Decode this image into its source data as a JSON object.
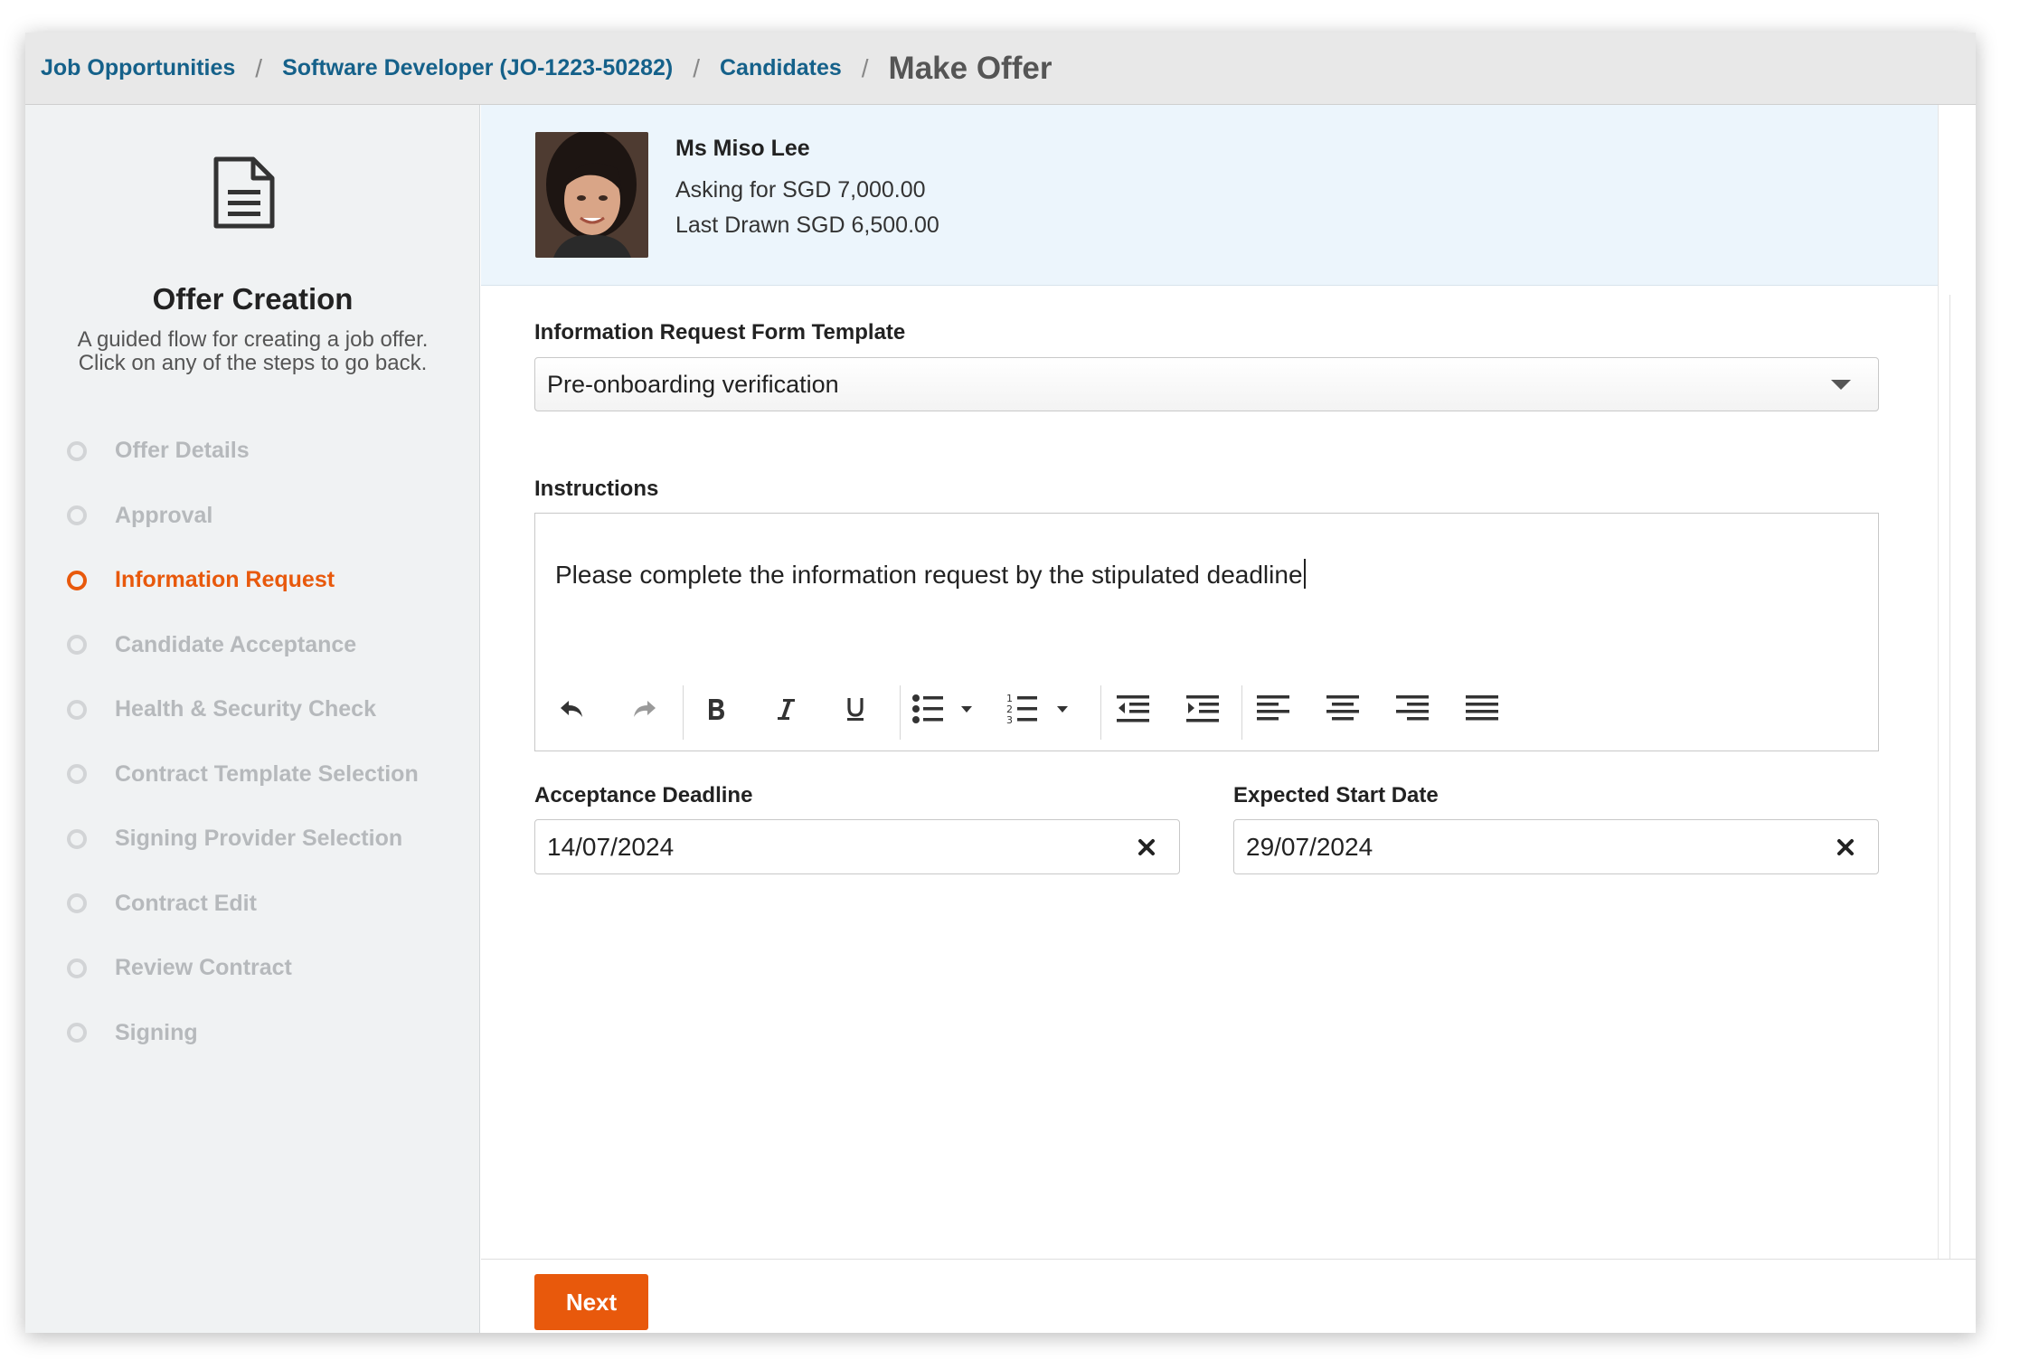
{
  "breadcrumb": {
    "items": [
      "Job Opportunities",
      "Software Developer (JO-1223-50282)",
      "Candidates"
    ],
    "separator": "/",
    "current": "Make Offer"
  },
  "sidebar": {
    "icon": "document-icon",
    "title": "Offer Creation",
    "description": "A guided flow for creating a job offer. Click on any of the steps to go back.",
    "steps": [
      {
        "label": "Offer Details"
      },
      {
        "label": "Approval"
      },
      {
        "label": "Information Request",
        "active": true
      },
      {
        "label": "Candidate Acceptance"
      },
      {
        "label": "Health & Security Check"
      },
      {
        "label": "Contract Template Selection"
      },
      {
        "label": "Signing Provider Selection"
      },
      {
        "label": "Contract Edit"
      },
      {
        "label": "Review Contract"
      },
      {
        "label": "Signing"
      }
    ]
  },
  "candidate": {
    "name": "Ms Miso Lee",
    "asking": "Asking for SGD 7,000.00",
    "last_drawn": "Last Drawn SGD 6,500.00"
  },
  "form": {
    "template_label": "Information Request Form Template",
    "template_value": "Pre-onboarding verification",
    "instructions_label": "Instructions",
    "instructions_value": "Please complete the information request by the stipulated deadline",
    "acceptance_label": "Acceptance Deadline",
    "acceptance_value": "14/07/2024",
    "start_label": "Expected Start Date",
    "start_value": "29/07/2024"
  },
  "toolbar_icons": [
    "undo-icon",
    "redo-icon",
    "bold-icon",
    "italic-icon",
    "underline-icon",
    "bullet-list-icon",
    "numbered-list-icon",
    "outdent-icon",
    "indent-icon",
    "align-left-icon",
    "align-center-icon",
    "align-right-icon",
    "align-justify-icon"
  ],
  "footer": {
    "next_label": "Next"
  },
  "colors": {
    "accent": "#e8590c",
    "link": "#15618a",
    "profile_bg": "#ecf5fc",
    "sidebar_bg": "#f0f2f3"
  }
}
